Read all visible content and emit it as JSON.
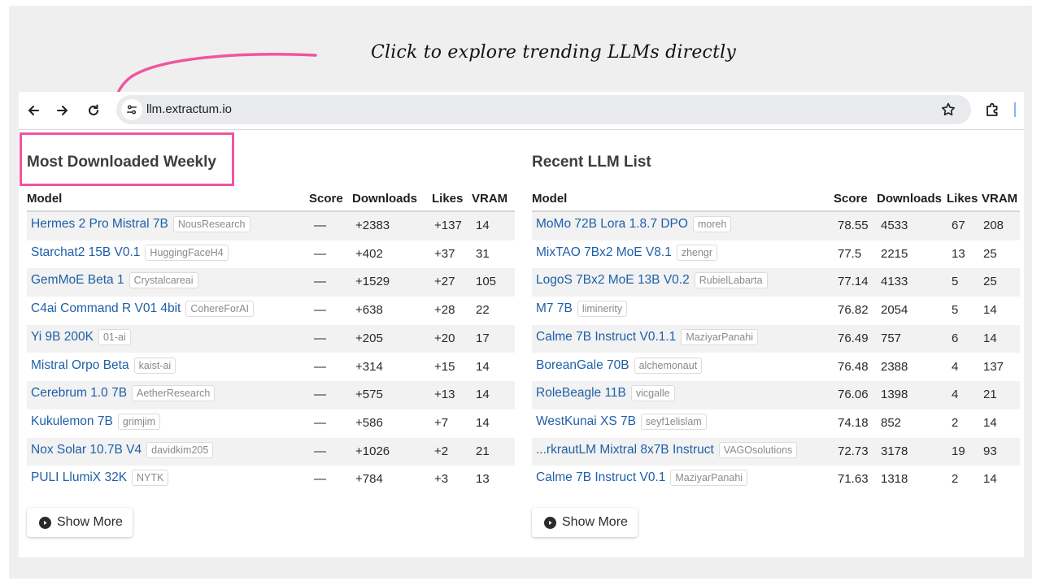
{
  "annotation": {
    "text": "Click to explore trending LLMs directly",
    "color": "#f0559f"
  },
  "browser": {
    "url": "llm.extractum.io"
  },
  "left_panel": {
    "title": "Most Downloaded Weekly",
    "columns": {
      "model": "Model",
      "score": "Score",
      "downloads": "Downloads",
      "likes": "Likes",
      "vram": "VRAM"
    },
    "rows": [
      {
        "model": "Hermes 2 Pro Mistral 7B",
        "author": "NousResearch",
        "score": "—",
        "downloads": "+2383",
        "likes": "+137",
        "vram": "14"
      },
      {
        "model": "Starchat2 15B V0.1",
        "author": "HuggingFaceH4",
        "score": "—",
        "downloads": "+402",
        "likes": "+37",
        "vram": "31"
      },
      {
        "model": "GemMoE Beta 1",
        "author": "Crystalcareai",
        "score": "—",
        "downloads": "+1529",
        "likes": "+27",
        "vram": "105"
      },
      {
        "model": "C4ai Command R V01 4bit",
        "author": "CohereForAI",
        "score": "—",
        "downloads": "+638",
        "likes": "+28",
        "vram": "22"
      },
      {
        "model": "Yi 9B 200K",
        "author": "01-ai",
        "score": "—",
        "downloads": "+205",
        "likes": "+20",
        "vram": "17"
      },
      {
        "model": "Mistral Orpo Beta",
        "author": "kaist-ai",
        "score": "—",
        "downloads": "+314",
        "likes": "+15",
        "vram": "14"
      },
      {
        "model": "Cerebrum 1.0 7B",
        "author": "AetherResearch",
        "score": "—",
        "downloads": "+575",
        "likes": "+13",
        "vram": "14"
      },
      {
        "model": "Kukulemon 7B",
        "author": "grimjim",
        "score": "—",
        "downloads": "+586",
        "likes": "+7",
        "vram": "14"
      },
      {
        "model": "Nox Solar 10.7B V4",
        "author": "davidkim205",
        "score": "—",
        "downloads": "+1026",
        "likes": "+2",
        "vram": "21"
      },
      {
        "model": "PULI LlumiX 32K",
        "author": "NYTK",
        "score": "—",
        "downloads": "+784",
        "likes": "+3",
        "vram": "13"
      }
    ],
    "show_more": "Show More"
  },
  "right_panel": {
    "title": "Recent LLM List",
    "columns": {
      "model": "Model",
      "score": "Score",
      "downloads": "Downloads",
      "likes": "Likes",
      "vram": "VRAM"
    },
    "rows": [
      {
        "model": "MoMo 72B Lora 1.8.7 DPO",
        "author": "moreh",
        "score": "78.55",
        "downloads": "4533",
        "likes": "67",
        "vram": "208"
      },
      {
        "model": "MixTAO 7Bx2 MoE V8.1",
        "author": "zhengr",
        "score": "77.5",
        "downloads": "2215",
        "likes": "13",
        "vram": "25"
      },
      {
        "model": "LogoS 7Bx2 MoE 13B V0.2",
        "author": "RubielLabarta",
        "score": "77.14",
        "downloads": "4133",
        "likes": "5",
        "vram": "25"
      },
      {
        "model": "M7 7B",
        "author": "liminerity",
        "score": "76.82",
        "downloads": "2054",
        "likes": "5",
        "vram": "14"
      },
      {
        "model": "Calme 7B Instruct V0.1.1",
        "author": "MaziyarPanahi",
        "score": "76.49",
        "downloads": "757",
        "likes": "6",
        "vram": "14"
      },
      {
        "model": "BoreanGale 70B",
        "author": "alchemonaut",
        "score": "76.48",
        "downloads": "2388",
        "likes": "4",
        "vram": "137"
      },
      {
        "model": "RoleBeagle 11B",
        "author": "vicgalle",
        "score": "76.06",
        "downloads": "1398",
        "likes": "4",
        "vram": "21"
      },
      {
        "model": "WestKunai XS 7B",
        "author": "seyf1elislam",
        "score": "74.18",
        "downloads": "852",
        "likes": "2",
        "vram": "14"
      },
      {
        "model": "...rkrautLM Mixtral 8x7B Instruct",
        "author": "VAGOsolutions",
        "score": "72.73",
        "downloads": "3178",
        "likes": "19",
        "vram": "93"
      },
      {
        "model": "Calme 7B Instruct V0.1",
        "author": "MaziyarPanahi",
        "score": "71.63",
        "downloads": "1318",
        "likes": "2",
        "vram": "14"
      }
    ],
    "show_more": "Show More"
  }
}
